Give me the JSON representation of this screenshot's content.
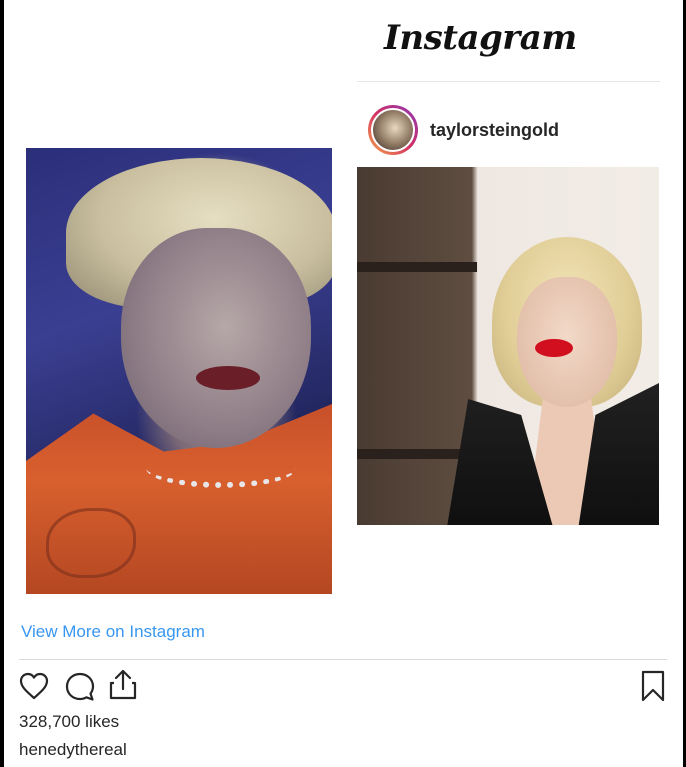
{
  "embed": {
    "brand": "Instagram",
    "post": {
      "username": "taylorsteingold"
    },
    "view_more_link": "View More on Instagram",
    "likes": "328,700 likes",
    "author": "henedythereal"
  },
  "icons": {
    "heart": "heart-icon",
    "comment": "comment-icon",
    "share": "share-icon",
    "bookmark": "bookmark-icon",
    "avatar": "avatar"
  },
  "colors": {
    "link": "#3897f0",
    "text": "#262626",
    "divider": "#dbdbdb"
  }
}
